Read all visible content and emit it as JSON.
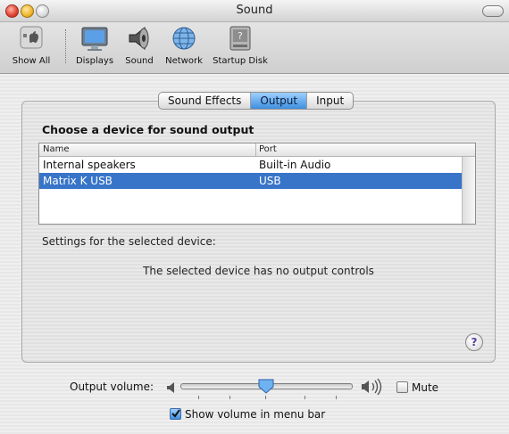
{
  "window": {
    "title": "Sound"
  },
  "toolbar": {
    "items": [
      {
        "label": "Show All"
      },
      {
        "label": "Displays"
      },
      {
        "label": "Sound"
      },
      {
        "label": "Network"
      },
      {
        "label": "Startup Disk"
      }
    ]
  },
  "tabs": [
    {
      "label": "Sound Effects",
      "selected": false
    },
    {
      "label": "Output",
      "selected": true
    },
    {
      "label": "Input",
      "selected": false
    }
  ],
  "output": {
    "heading": "Choose a device for sound output",
    "columns": [
      "Name",
      "Port"
    ],
    "rows": [
      {
        "name": "Internal speakers",
        "port": "Built-in Audio",
        "selected": false
      },
      {
        "name": "Matrix K USB",
        "port": "USB",
        "selected": true
      }
    ],
    "settings_label": "Settings for the selected device:",
    "no_controls": "The selected device has no output controls"
  },
  "help": {
    "symbol": "?"
  },
  "volume": {
    "label": "Output volume:",
    "level": 0.52,
    "mute_label": "Mute",
    "mute_checked": false,
    "show_in_menubar_label": "Show volume in menu bar",
    "show_in_menubar_checked": true
  },
  "colors": {
    "selection": "#3875c9",
    "tab_selected": "#5aa6f0"
  }
}
